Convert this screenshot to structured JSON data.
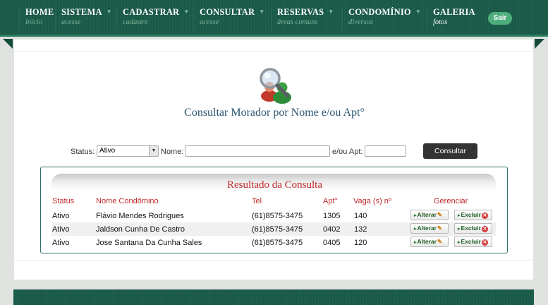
{
  "nav": [
    {
      "title": "HOME",
      "sub": "início",
      "caret": false
    },
    {
      "title": "SISTEMA",
      "sub": "acesse",
      "caret": true
    },
    {
      "title": "CADASTRAR",
      "sub": "cadastre",
      "caret": true
    },
    {
      "title": "CONSULTAR",
      "sub": "acesse",
      "caret": true
    },
    {
      "title": "RESERVAS",
      "sub": "áreas comuns",
      "caret": true
    },
    {
      "title": "CONDOMÍNIO",
      "sub": "diversos",
      "caret": true
    },
    {
      "title": "GALERIA",
      "sub": "fotos",
      "caret": false
    }
  ],
  "logout_label": "Sair",
  "page_title": "Consultar Morador por Nome e/ou Apt°",
  "filters": {
    "status_label": "Status:",
    "status_value": "Ativo",
    "name_label": "Nome:",
    "name_value": "",
    "apt_label": "e/ou Apt:",
    "apt_value": "",
    "submit_label": "Consultar"
  },
  "results": {
    "title": "Resultado da Consulta",
    "headers": {
      "status": "Status",
      "name": "Nome Condômino",
      "tel": "Tel",
      "apt": "Apt°",
      "vaga": "Vaga (s) nº",
      "manage": "Gerenciar"
    },
    "rows": [
      {
        "status": "Ativo",
        "name": "Flávio Mendes Rodrigues",
        "tel": "(61)8575-3475",
        "apt": "1305",
        "vaga": "140"
      },
      {
        "status": "Ativo",
        "name": "Jaldson Cunha De Castro",
        "tel": "(61)8575-3475",
        "apt": "0402",
        "vaga": "132"
      },
      {
        "status": "Ativo",
        "name": "Jose Santana Da Cunha Sales",
        "tel": "(61)8575-3475",
        "apt": "0405",
        "vaga": "120"
      }
    ],
    "edit_label": "Alterar",
    "delete_label": "Excluir"
  },
  "colors": {
    "nav_bg": "#1a5a48",
    "accent_red": "#c0282a",
    "title_blue": "#2b5573",
    "logout_green": "#4cae7c"
  }
}
